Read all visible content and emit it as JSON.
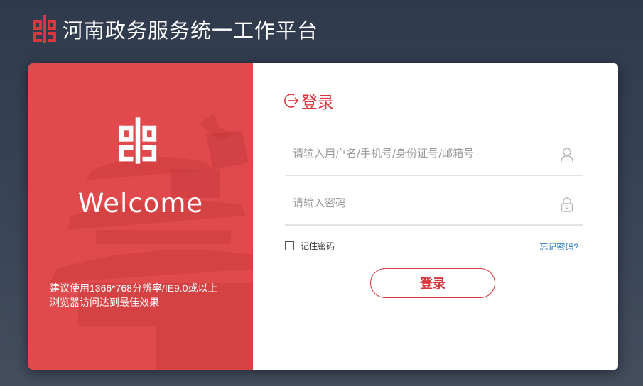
{
  "header": {
    "title": "河南政务服务统一工作平台"
  },
  "left_panel": {
    "welcome": "Welcome",
    "tip_line1": "建议使用1366*768分辨率/IE9.0或以上",
    "tip_line2": "浏览器访问达到最佳效果"
  },
  "login": {
    "heading": "登录",
    "username_placeholder": "请输入用户名/手机号/身份证号/邮箱号",
    "password_placeholder": "请输入密码",
    "remember_label": "记住密码",
    "forgot_label": "忘记密码?",
    "submit_label": "登录"
  },
  "colors": {
    "brand_red": "#d9363e",
    "panel_red": "#e04a4c",
    "link_blue": "#2a7bd3",
    "page_bg": "#2f3a4d"
  },
  "icons": {
    "logo": "henan-gov-logo-icon",
    "login": "login-arrow-icon",
    "user": "user-icon",
    "lock": "lock-icon"
  }
}
